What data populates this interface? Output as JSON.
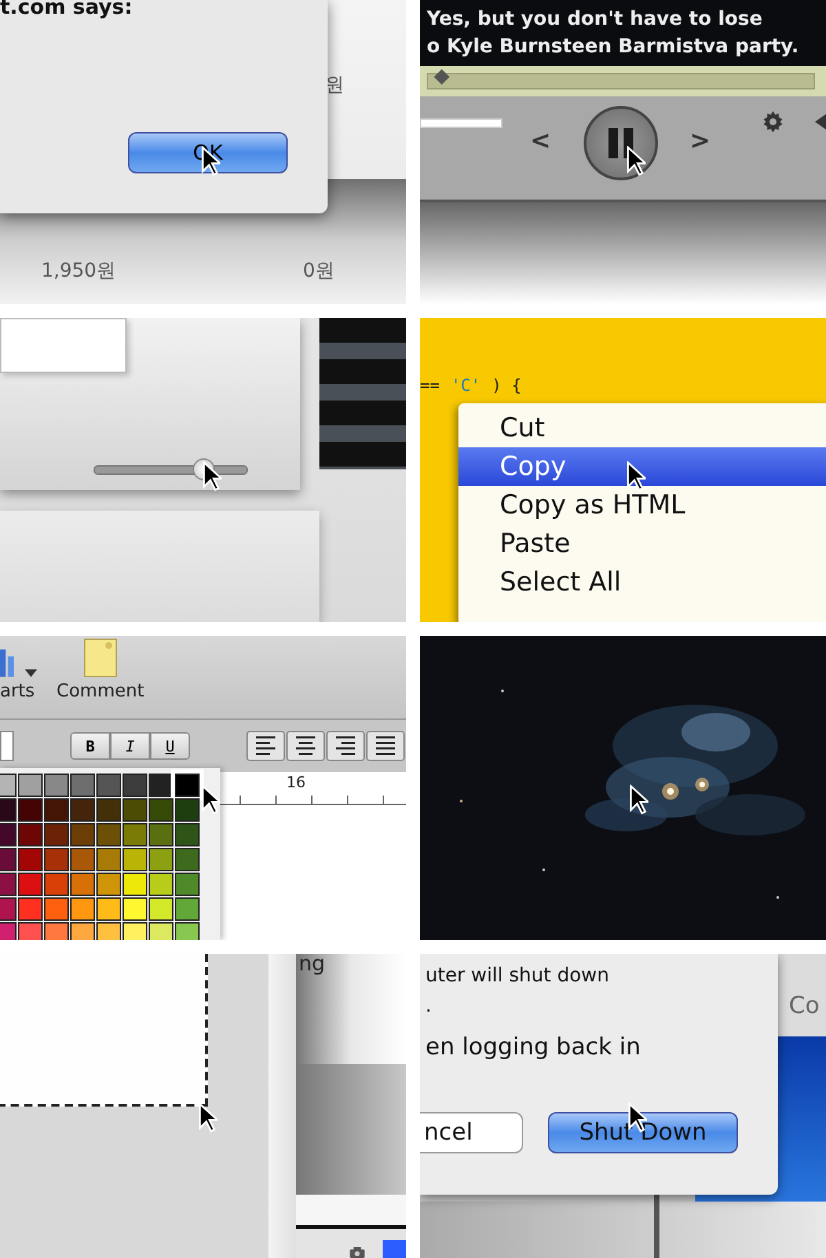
{
  "tiles": [
    {
      "kind": "alert",
      "title": "t.com says:",
      "button": "OK",
      "cells": [
        {
          "text": "원"
        },
        {
          "text": "1,950원"
        },
        {
          "text": "0원"
        }
      ]
    },
    {
      "kind": "player",
      "subtitles": [
        "Yes, but you don't have to lose",
        "o Kyle Burnsteen Barmistva party."
      ],
      "progress": {
        "level": 0.03
      },
      "controls": [
        {
          "kind": "glyph",
          "label": "<"
        },
        {
          "kind": "pause"
        },
        {
          "kind": "glyph",
          "label": ">"
        },
        {
          "kind": "gear"
        },
        {
          "kind": "speaker"
        }
      ]
    },
    {
      "kind": "slider",
      "slider": {
        "level": 0.72
      }
    },
    {
      "kind": "menu",
      "code": [
        {
          "kind": "op",
          "text": "=="
        },
        {
          "kind": "string",
          "text": "'C'"
        },
        {
          "kind": "op",
          "text": ") {"
        }
      ],
      "items": [
        {
          "label": "Cut",
          "selected": false
        },
        {
          "label": "Copy",
          "selected": true
        },
        {
          "label": "Copy as HTML",
          "selected": false
        },
        {
          "label": "Paste",
          "selected": false
        },
        {
          "label": "Select All",
          "selected": false
        }
      ]
    },
    {
      "kind": "palette",
      "toolbar": [
        {
          "kind": "chart",
          "label": "arts"
        },
        {
          "kind": "note",
          "label": "Comment"
        }
      ],
      "styles": [
        "B",
        "I",
        "U"
      ],
      "ruler": "16",
      "swatches": [
        [
          {
            "color": "#b4b4b4",
            "selected": false
          },
          {
            "color": "#a0a0a0",
            "selected": false
          },
          {
            "color": "#888888",
            "selected": false
          },
          {
            "color": "#6e6e6e",
            "selected": false
          },
          {
            "color": "#555555",
            "selected": false
          },
          {
            "color": "#3c3c3c",
            "selected": false
          },
          {
            "color": "#222222",
            "selected": false
          },
          {
            "color": "#000000",
            "selected": true
          }
        ],
        [
          {
            "color": "#2a0818",
            "selected": false
          },
          {
            "color": "#440404",
            "selected": false
          },
          {
            "color": "#441404",
            "selected": false
          },
          {
            "color": "#44240a",
            "selected": false
          },
          {
            "color": "#443008",
            "selected": false
          },
          {
            "color": "#4c4c04",
            "selected": false
          },
          {
            "color": "#364a08",
            "selected": false
          },
          {
            "color": "#1e3e10",
            "selected": false
          }
        ],
        [
          {
            "color": "#44082a",
            "selected": false
          },
          {
            "color": "#6e0606",
            "selected": false
          },
          {
            "color": "#6c2206",
            "selected": false
          },
          {
            "color": "#6c3e06",
            "selected": false
          },
          {
            "color": "#6c5006",
            "selected": false
          },
          {
            "color": "#7a7a06",
            "selected": false
          },
          {
            "color": "#5a7010",
            "selected": false
          },
          {
            "color": "#2e5418",
            "selected": false
          }
        ],
        [
          {
            "color": "#6a0c3a",
            "selected": false
          },
          {
            "color": "#a40606",
            "selected": false
          },
          {
            "color": "#a83006",
            "selected": false
          },
          {
            "color": "#a85806",
            "selected": false
          },
          {
            "color": "#a87a06",
            "selected": false
          },
          {
            "color": "#bab406",
            "selected": false
          },
          {
            "color": "#8ca012",
            "selected": false
          },
          {
            "color": "#3e6a1e",
            "selected": false
          }
        ],
        [
          {
            "color": "#8c1044",
            "selected": false
          },
          {
            "color": "#dc1010",
            "selected": false
          },
          {
            "color": "#d84008",
            "selected": false
          },
          {
            "color": "#d87008",
            "selected": false
          },
          {
            "color": "#d09408",
            "selected": false
          },
          {
            "color": "#eee808",
            "selected": false
          },
          {
            "color": "#b8cc1a",
            "selected": false
          },
          {
            "color": "#4e8a2a",
            "selected": false
          }
        ],
        [
          {
            "color": "#b01450",
            "selected": false
          },
          {
            "color": "#ff3020",
            "selected": false
          },
          {
            "color": "#ff6010",
            "selected": false
          },
          {
            "color": "#ff9810",
            "selected": false
          },
          {
            "color": "#ffbc18",
            "selected": false
          },
          {
            "color": "#fff830",
            "selected": false
          },
          {
            "color": "#d4e82a",
            "selected": false
          },
          {
            "color": "#62a838",
            "selected": false
          }
        ],
        [
          {
            "color": "#d02070",
            "selected": false
          },
          {
            "color": "#ff5050",
            "selected": false
          },
          {
            "color": "#ff7840",
            "selected": false
          },
          {
            "color": "#ffa840",
            "selected": false
          },
          {
            "color": "#ffc040",
            "selected": false
          },
          {
            "color": "#fff060",
            "selected": false
          },
          {
            "color": "#dce860",
            "selected": false
          },
          {
            "color": "#88c850",
            "selected": false
          }
        ]
      ]
    },
    {
      "kind": "picture"
    },
    {
      "kind": "selection",
      "caption": "ng"
    },
    {
      "kind": "shutdown",
      "lines": [
        "uter will shut down",
        ".",
        "en logging back in"
      ],
      "buttons": [
        {
          "label": "ncel",
          "default": false
        },
        {
          "label": "Shut Down",
          "default": true
        }
      ],
      "background_label": "Co"
    }
  ]
}
